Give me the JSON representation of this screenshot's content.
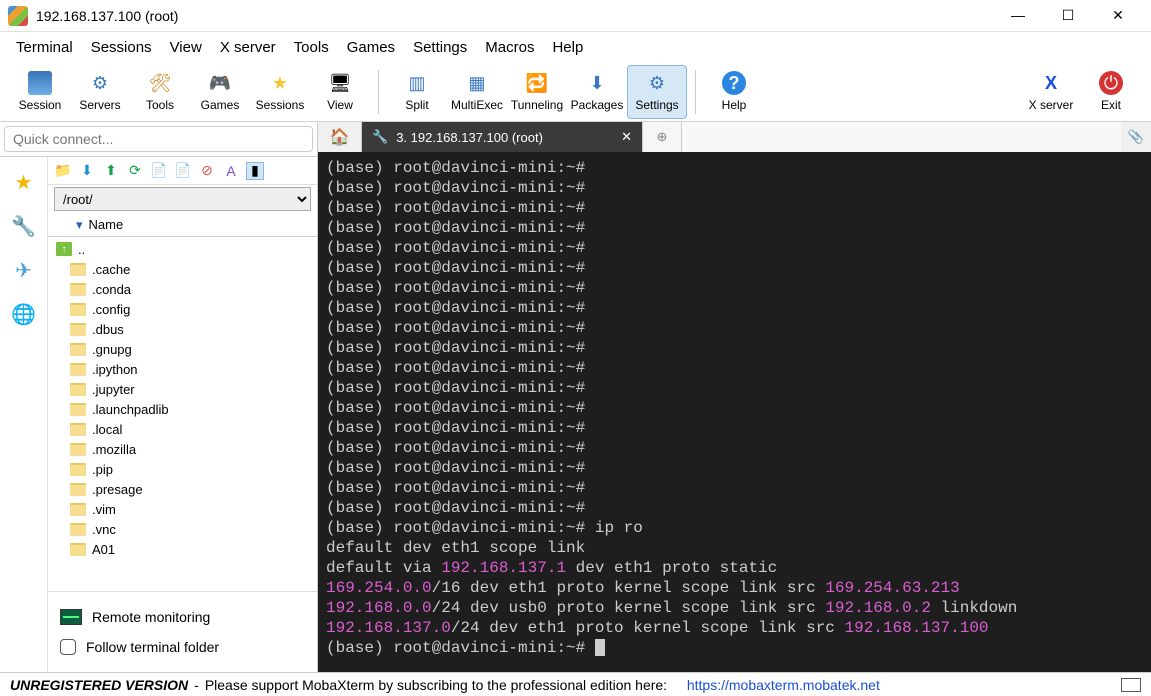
{
  "window": {
    "title": "192.168.137.100 (root)",
    "min": "—",
    "max": "☐",
    "close": "✕"
  },
  "menu": [
    "Terminal",
    "Sessions",
    "View",
    "X server",
    "Tools",
    "Games",
    "Settings",
    "Macros",
    "Help"
  ],
  "toolbar": {
    "items": [
      "Session",
      "Servers",
      "Tools",
      "Games",
      "Sessions",
      "View",
      "Split",
      "MultiExec",
      "Tunneling",
      "Packages",
      "Settings",
      "Help"
    ],
    "right": [
      "X server",
      "Exit"
    ]
  },
  "quickconnect_placeholder": "Quick connect...",
  "sftp": {
    "path": "/root/",
    "name_header": "Name",
    "updir": "..",
    "folders": [
      ".cache",
      ".conda",
      ".config",
      ".dbus",
      ".gnupg",
      ".ipython",
      ".jupyter",
      ".launchpadlib",
      ".local",
      ".mozilla",
      ".pip",
      ".presage",
      ".vim",
      ".vnc",
      "A01"
    ],
    "remote_monitoring": "Remote monitoring",
    "follow": "Follow terminal folder"
  },
  "tab": {
    "home_glyph": "🏠",
    "label": "3. 192.168.137.100 (root)",
    "close": "✕",
    "add": "⊕",
    "clip": "📎"
  },
  "terminal": {
    "prompt": "(base) root@davinci-mini:~#",
    "blank_count": 18,
    "cmd": " ip ro",
    "out1_a": "default dev eth1 scope link",
    "out2": {
      "a": "default via ",
      "ip": "192.168.137.1",
      "b": " dev eth1 proto static"
    },
    "out3": {
      "ip1": "169.254.0.0",
      "mid": "/16 dev eth1 proto kernel scope link src ",
      "ip2": "169.254.63.213"
    },
    "out4": {
      "ip1": "192.168.0.0",
      "mid": "/24 dev usb0 proto kernel scope link src ",
      "ip2": "192.168.0.2",
      "tail": " linkdown"
    },
    "out5": {
      "ip1": "192.168.137.0",
      "mid": "/24 dev eth1 proto kernel scope link src ",
      "ip2": "192.168.137.100"
    }
  },
  "status": {
    "unreg": "UNREGISTERED VERSION",
    "dash": " - ",
    "msg": "Please support MobaXterm by subscribing to the professional edition here:",
    "link": "https://mobaxterm.mobatek.net"
  }
}
